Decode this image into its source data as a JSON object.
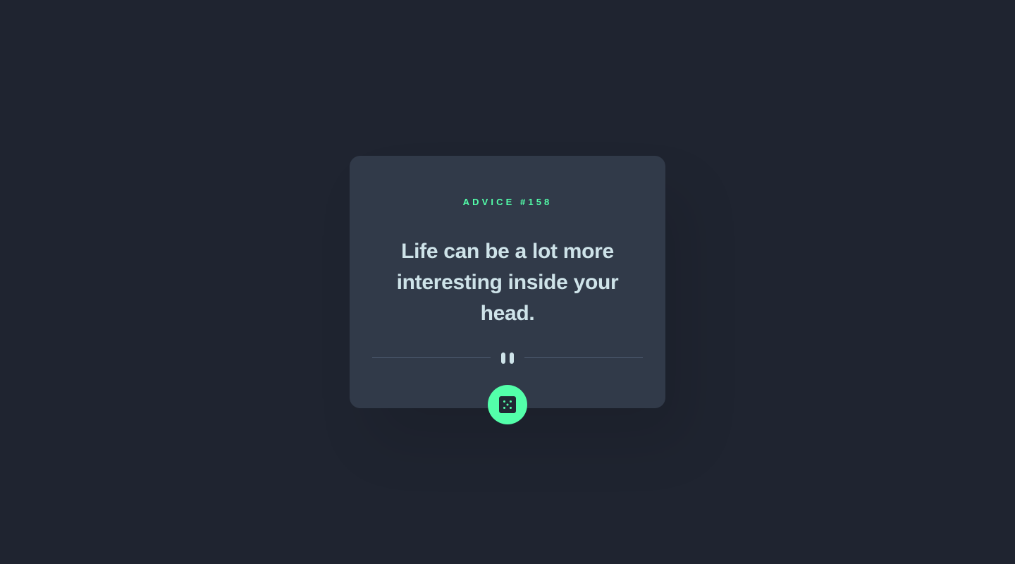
{
  "advice": {
    "label": "ADVICE #158",
    "text": "Life can be a lot more interesting inside your head."
  },
  "controls": {
    "divider_icon": "pause-icon",
    "generate_button_icon": "dice-icon"
  },
  "colors": {
    "background": "#1f2430",
    "card": "#313a49",
    "accent": "#53ffaa",
    "text": "#cee3e9",
    "divider": "#4f5d74"
  }
}
